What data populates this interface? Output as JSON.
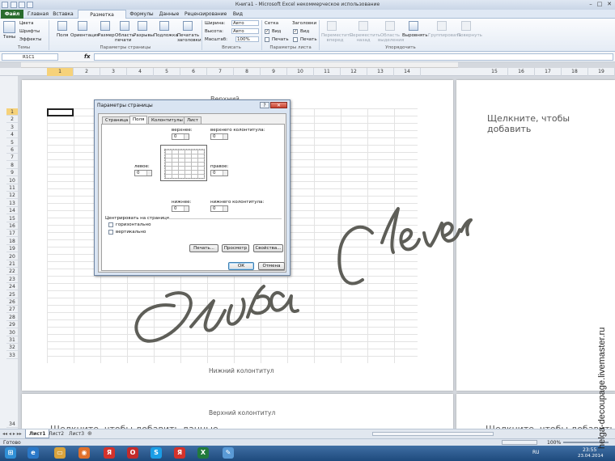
{
  "window": {
    "title": "Книга1 - Microsoft Excel некоммерческое использование",
    "controls": [
      "–",
      "□",
      "✕"
    ]
  },
  "tabs": [
    {
      "label": "Файл"
    },
    {
      "label": "Главная"
    },
    {
      "label": "Вставка"
    },
    {
      "label": "Разметка страницы"
    },
    {
      "label": "Формулы"
    },
    {
      "label": "Данные"
    },
    {
      "label": "Рецензирование"
    },
    {
      "label": "Вид"
    }
  ],
  "ribbon": {
    "themes": {
      "btn": "Темы",
      "colors": "Цвета",
      "fonts": "Шрифты",
      "effects": "Эффекты",
      "group": "Темы"
    },
    "page_setup": {
      "margins": "Поля",
      "orientation": "Ориентация",
      "size": "Размер",
      "print_area": "Область печати",
      "breaks": "Разрывы",
      "background": "Подложка",
      "titles": "Печатать заголовки",
      "group": "Параметры страницы"
    },
    "scale": {
      "width_lbl": "Ширина:",
      "width_val": "Авто",
      "height_lbl": "Высота:",
      "height_val": "Авто",
      "scale_lbl": "Масштаб:",
      "scale_val": "100%",
      "group": "Вписать"
    },
    "sheet_opts": {
      "grid": "Сетка",
      "headings": "Заголовки",
      "view1": "Вид",
      "print1": "Печать",
      "view2": "Вид",
      "print2": "Печать",
      "group": "Параметры листа"
    },
    "arrange": {
      "forward": "Переместить вперед",
      "back": "Переместить назад",
      "pane": "Область выделения",
      "align": "Выровнять",
      "group_btn": "Группировать",
      "rotate": "Повернуть",
      "group": "Упорядочить"
    }
  },
  "formula_bar": {
    "name_box": "R1C1",
    "fx": "fx"
  },
  "columns_left": [
    "1",
    "2",
    "3",
    "4",
    "5",
    "6",
    "7",
    "8",
    "9",
    "10",
    "11",
    "12",
    "13",
    "14"
  ],
  "columns_right": [
    "15",
    "16",
    "17",
    "18",
    "19"
  ],
  "rows": [
    "1",
    "2",
    "3",
    "4",
    "5",
    "6",
    "7",
    "8",
    "9",
    "10",
    "11",
    "12",
    "13",
    "14",
    "15",
    "16",
    "17",
    "18",
    "19",
    "20",
    "21",
    "22",
    "23",
    "24",
    "25",
    "26",
    "27",
    "28",
    "29",
    "30",
    "31",
    "32",
    "33"
  ],
  "row_bottom": "34",
  "page": {
    "header_hint_right": "Щелкните, чтобы добавить",
    "footer_label": "Нижний колонтитул",
    "header_label2": "Верхний колонтитул",
    "header_hint_bottom_left": "Щелкните, чтобы добавить данные",
    "header_hint_bottom_right": "Щелкните, чтобы добавить",
    "top_hint": "Верхний"
  },
  "dialog": {
    "title": "Параметры страницы",
    "tabs": [
      "Страница",
      "Поля",
      "Колонтитулы",
      "Лист"
    ],
    "top_lbl": "верхнее:",
    "top_val": "0",
    "header_lbl": "верхнего колонтитула:",
    "header_val": "0",
    "left_lbl": "левое:",
    "left_val": "0",
    "right_lbl": "правое:",
    "right_val": "0",
    "bottom_lbl": "нижнее:",
    "bottom_val": "0",
    "footer_lbl": "нижнего колонтитула:",
    "footer_val": "0",
    "center_lbl": "Центрировать на странице",
    "horiz": "горизонтально",
    "vert": "вертикально",
    "print_btn": "Печать...",
    "preview_btn": "Просмотр",
    "props_btn": "Свойства...",
    "ok_btn": "ОК",
    "cancel_btn": "Отмена"
  },
  "sheets": [
    {
      "label": "Лист1"
    },
    {
      "label": "Лист2"
    },
    {
      "label": "Лист3"
    }
  ],
  "status": {
    "ready": "Готово",
    "zoom": "100%"
  },
  "taskbar": {
    "lang": "RU",
    "time": "23:55",
    "date": "23.04.2014",
    "icons": [
      {
        "name": "start",
        "glyph": "⊞",
        "color": "#2f8fd6"
      },
      {
        "name": "ie",
        "glyph": "e",
        "color": "#2a78c8"
      },
      {
        "name": "explorer",
        "glyph": "▭",
        "color": "#d9a33c"
      },
      {
        "name": "firefox",
        "glyph": "◉",
        "color": "#e0702b"
      },
      {
        "name": "yandex",
        "glyph": "Я",
        "color": "#d4322c"
      },
      {
        "name": "opera",
        "glyph": "O",
        "color": "#c42b2b"
      },
      {
        "name": "skype",
        "glyph": "S",
        "color": "#1a9ee6"
      },
      {
        "name": "yandex2",
        "glyph": "Я",
        "color": "#d4322c"
      },
      {
        "name": "excel",
        "glyph": "X",
        "color": "#217a3c"
      },
      {
        "name": "paint",
        "glyph": "✎",
        "color": "#5a9ad6"
      }
    ]
  },
  "watermark": "helga-decoupage.livemaster.ru",
  "accent": "#2a6c2e"
}
